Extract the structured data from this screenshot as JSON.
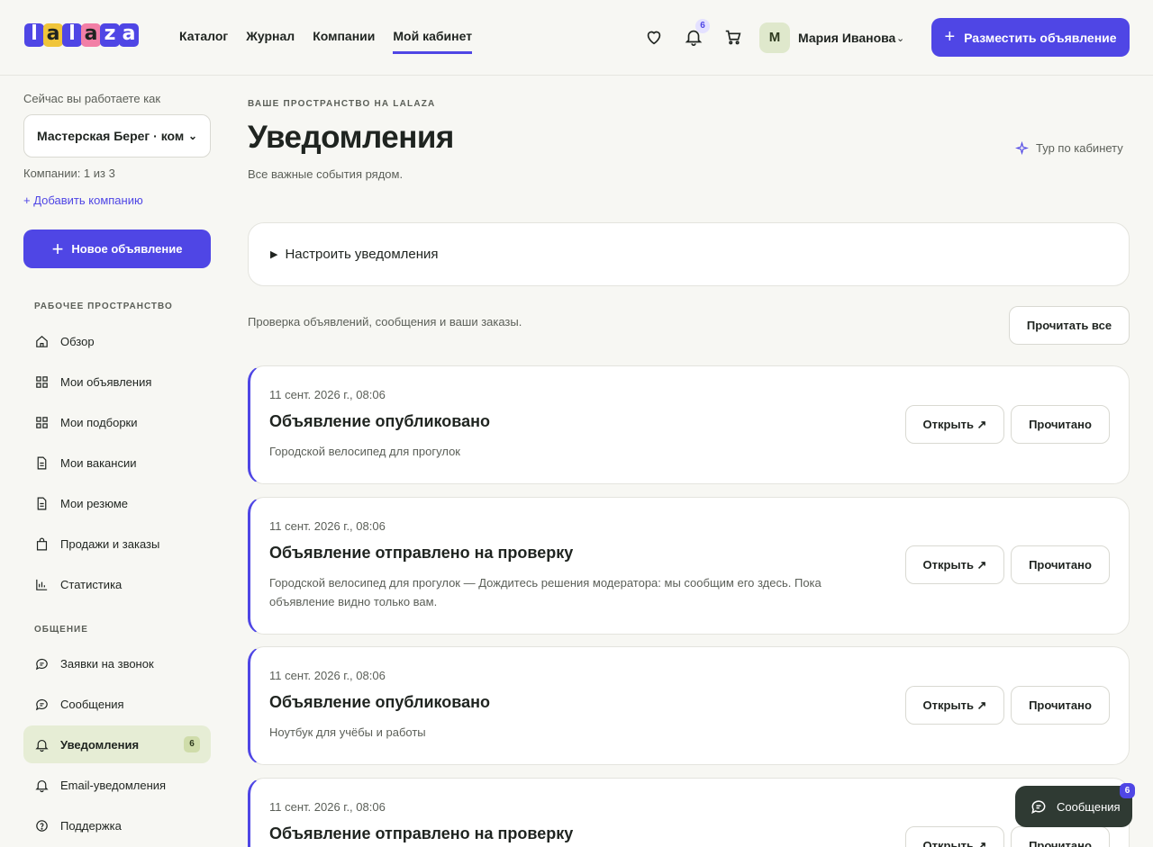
{
  "header": {
    "logo_letters": [
      "l",
      "a",
      "l",
      "a",
      "z",
      "a"
    ],
    "logo_colors": [
      "#4f46e5",
      "#f0c53a",
      "#4f46e5",
      "#f27fa6",
      "#4f46e5",
      "#4f46e5"
    ],
    "nav": [
      "Каталог",
      "Журнал",
      "Компании",
      "Мой кабинет"
    ],
    "nav_active_index": 3,
    "notifications_badge": "6",
    "user_initial": "М",
    "user_name": "Мария Иванова",
    "post_button": "Разместить объявление",
    "icons": [
      "heart-icon",
      "bell-icon",
      "cart-icon",
      "chevron-down-icon"
    ]
  },
  "sidebar": {
    "works_as_label": "Сейчас вы работаете как",
    "company_value": "Мастерская Берег · ком",
    "companies_count": "Компании: 1 из 3",
    "add_company": "+ Добавить компанию",
    "new_ad_button": "Новое объявление",
    "sections": [
      {
        "title": "РАБОЧЕЕ ПРОСТРАНСТВО",
        "items": [
          {
            "label": "Обзор",
            "icon": "home-icon"
          },
          {
            "label": "Мои объявления",
            "icon": "grid-icon"
          },
          {
            "label": "Мои подборки",
            "icon": "grid-icon"
          },
          {
            "label": "Мои вакансии",
            "icon": "document-icon"
          },
          {
            "label": "Мои резюме",
            "icon": "document-icon"
          },
          {
            "label": "Продажи и заказы",
            "icon": "bag-icon"
          },
          {
            "label": "Статистика",
            "icon": "chart-icon"
          }
        ]
      },
      {
        "title": "ОБЩЕНИЕ",
        "items": [
          {
            "label": "Заявки на звонок",
            "icon": "chat-icon"
          },
          {
            "label": "Сообщения",
            "icon": "chat-icon"
          },
          {
            "label": "Уведомления",
            "icon": "bell-icon",
            "badge": "6",
            "active": true
          },
          {
            "label": "Email-уведомления",
            "icon": "bell-icon"
          },
          {
            "label": "Поддержка",
            "icon": "help-icon"
          }
        ]
      }
    ]
  },
  "main": {
    "kicker": "ВАШЕ ПРОСТРАНСТВО НА LALAZA",
    "title": "Уведомления",
    "subtitle": "Все важные события рядом.",
    "tour": "Тур по кабинету",
    "settings_toggle": "Настроить уведомления",
    "feed_description": "Проверка объявлений, сообщения и ваши заказы.",
    "read_all": "Прочитать все",
    "open_label": "Открыть ↗",
    "read_label": "Прочитано",
    "notifications": [
      {
        "date": "11 сент. 2026 г., 08:06",
        "title": "Объявление опубликовано",
        "text": "Городской велосипед для прогулок"
      },
      {
        "date": "11 сент. 2026 г., 08:06",
        "title": "Объявление отправлено на проверку",
        "text": "Городской велосипед для прогулок — Дождитесь решения модератора: мы сообщим его здесь. Пока объявление видно только вам."
      },
      {
        "date": "11 сент. 2026 г., 08:06",
        "title": "Объявление опубликовано",
        "text": "Ноутбук для учёбы и работы"
      },
      {
        "date": "11 сент. 2026 г., 08:06",
        "title": "Объявление отправлено на проверку",
        "text": ""
      }
    ]
  },
  "messages_fab": {
    "label": "Сообщения",
    "badge": "6"
  },
  "colors": {
    "accent": "#4f46e5",
    "active_bg": "#e6edd5",
    "fab_bg": "#2f3a33"
  }
}
